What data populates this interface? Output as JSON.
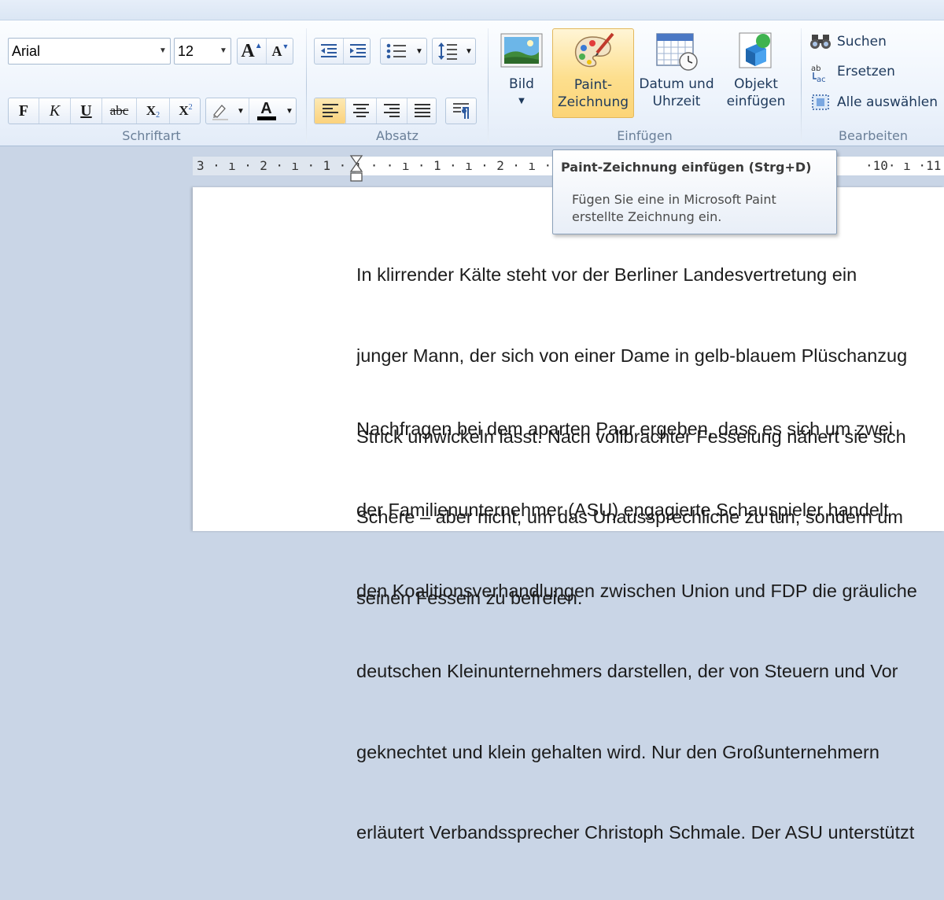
{
  "ribbon": {
    "font": {
      "family_value": "Arial",
      "size_value": "12",
      "grow_label": "A",
      "shrink_label": "A",
      "bold_label": "F",
      "italic_label": "K",
      "underline_label": "U",
      "strike_label": "abc",
      "subscript_label": "X",
      "superscript_label": "X",
      "color_label": "A",
      "group_label": "Schriftart"
    },
    "paragraph": {
      "group_label": "Absatz"
    },
    "insert": {
      "picture_label": "Bild",
      "paint_label_1": "Paint-",
      "paint_label_2": "Zeichnung",
      "datetime_label_1": "Datum und",
      "datetime_label_2": "Uhrzeit",
      "object_label_1": "Objekt",
      "object_label_2": "einfügen",
      "group_label": "Einfügen"
    },
    "edit": {
      "find_label": "Suchen",
      "replace_label": "Ersetzen",
      "select_all_label": "Alle auswählen",
      "group_label": "Bearbeiten"
    }
  },
  "ruler": {
    "left_marks": "3 · ı · 2 · ı · 1 · ı ·   · ı · 1 · ı · 2 · ı · 3 · ı",
    "right_marks": "·10· ı ·11 ·"
  },
  "tooltip": {
    "title": "Paint-Zeichnung einfügen (Strg+D)",
    "description": "Fügen Sie eine in Microsoft Paint erstellte Zeichnung ein."
  },
  "document": {
    "paragraph1": [
      "In klirrender Kälte steht vor der Berliner Landesvertretung ein",
      "junger Mann, der sich von einer Dame in gelb-blauem Plüschanzug",
      "Strick umwickeln lässt. Nach vollbrachter Fesselung nähert sie sich",
      "Schere – aber nicht, um das Unaussprechliche zu tun, sondern um",
      "seinen Fesseln zu befreien."
    ],
    "paragraph2": [
      "Nachfragen bei dem aparten Paar ergeben, dass es sich um zwei",
      "der Familienunternehmer (ASU) engagierte Schauspieler handelt",
      "den Koalitionsverhandlungen zwischen Union und FDP die gräuliche",
      "deutschen Kleinunternehmers darstellen, der von Steuern und Vor",
      "geknechtet und klein gehalten wird. Nur den Großunternehmern",
      "erläutert Verbandssprecher Christoph Schmale. Der ASU unterstützt"
    ]
  }
}
